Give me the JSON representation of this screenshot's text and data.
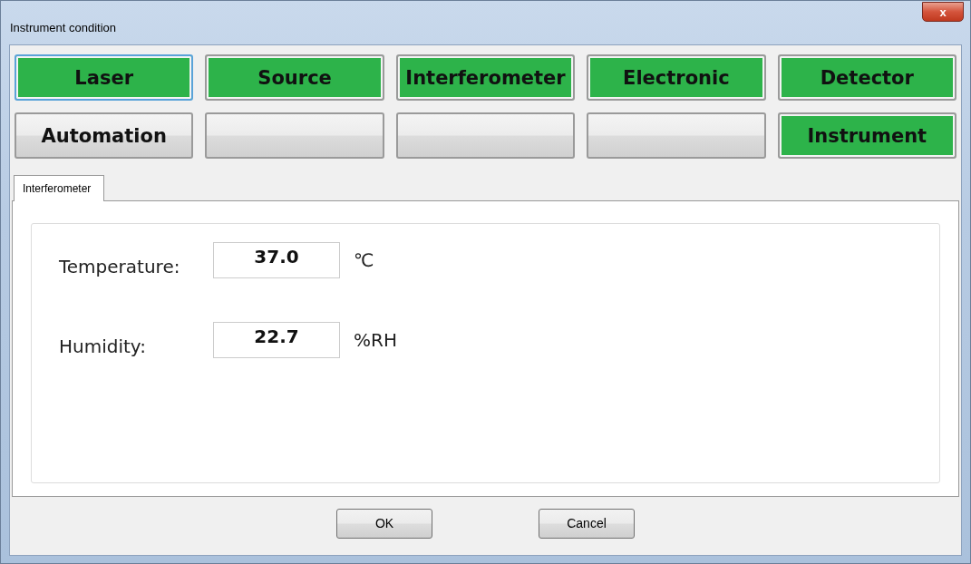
{
  "window": {
    "title": "Instrument condition",
    "close": "x"
  },
  "modules": [
    {
      "label": "Laser",
      "active": true,
      "focused": true
    },
    {
      "label": "Source",
      "active": true,
      "focused": false
    },
    {
      "label": "Interferometer",
      "active": true,
      "focused": false
    },
    {
      "label": "Electronic",
      "active": true,
      "focused": false
    },
    {
      "label": "Detector",
      "active": true,
      "focused": false
    },
    {
      "label": "Automation",
      "active": false,
      "focused": false
    },
    {
      "active": false,
      "focused": false
    },
    {
      "active": false,
      "focused": false
    },
    {
      "active": false,
      "focused": false
    },
    {
      "label": "Instrument",
      "active": true,
      "focused": false
    }
  ],
  "tabs": [
    {
      "label": "Interferometer",
      "selected": true
    }
  ],
  "fields": [
    {
      "label": "Temperature:",
      "value": "37.0",
      "unit": "℃"
    },
    {
      "label": "Humidity:",
      "value": "22.7",
      "unit": "%RH"
    }
  ],
  "buttons": [
    "OK",
    "Cancel"
  ]
}
